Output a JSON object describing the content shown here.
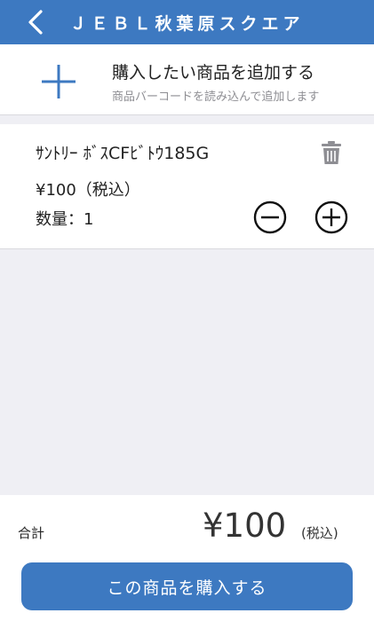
{
  "header": {
    "title": "ＪＥＢＬ秋葉原スクエア",
    "back_icon": "chevron-left-icon",
    "background": "#3d79c1"
  },
  "add_product": {
    "icon": "plus-icon",
    "title": "購入したい商品を追加する",
    "subtitle": "商品バーコードを読み込んで追加します"
  },
  "cart": {
    "items": [
      {
        "name": "ｻﾝﾄﾘｰ ﾎﾞｽCFﾋﾞﾄｳ185G",
        "price": "¥100（税込）",
        "quantity": "数量：1",
        "delete_icon": "trash-icon",
        "decrement_icon": "minus-circle-icon",
        "increment_icon": "plus-circle-icon"
      }
    ]
  },
  "footer": {
    "total_label": "合計",
    "total_amount": "¥100",
    "total_tax_note": "(税込)",
    "purchase_button": "この商品を購入する"
  },
  "colors": {
    "accent": "#3d79c1",
    "background": "#efeff4",
    "icon_gray": "#8e8e93"
  }
}
